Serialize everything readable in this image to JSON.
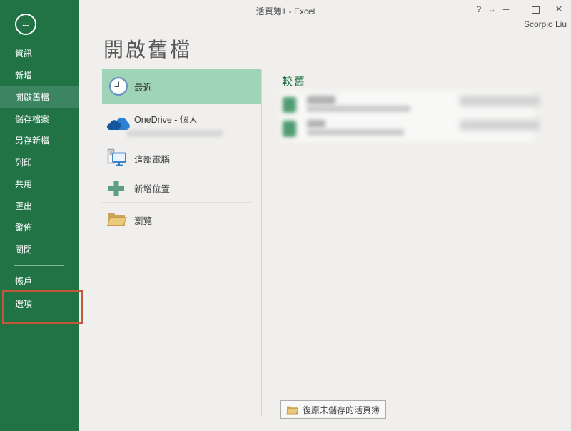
{
  "titlebar": {
    "title": "活頁簿1 - Excel",
    "user": "Scorpio Liu",
    "controls": {
      "help": "?",
      "fullscreen": "↔",
      "minimize": "─",
      "close": "✕"
    }
  },
  "sidebar": {
    "items": [
      {
        "label": "資訊"
      },
      {
        "label": "新增"
      },
      {
        "label": "開啟舊檔",
        "selected": true
      },
      {
        "label": "儲存檔案"
      },
      {
        "label": "另存新檔"
      },
      {
        "label": "列印"
      },
      {
        "label": "共用"
      },
      {
        "label": "匯出"
      },
      {
        "label": "發佈"
      },
      {
        "label": "關閉"
      }
    ],
    "footer_items": [
      {
        "label": "帳戶"
      },
      {
        "label": "選項",
        "annotated": true
      }
    ],
    "colors": {
      "bg": "#217346",
      "selected_bg": "#3b8560",
      "annotation_border": "#c05a3b"
    }
  },
  "main": {
    "page_title": "開啟舊檔",
    "places": [
      {
        "label": "最近",
        "icon": "clock-icon",
        "selected": true
      },
      {
        "label": "OneDrive - 個人",
        "icon": "onedrive-icon",
        "subtext_blurred": true
      },
      {
        "label": "這部電腦",
        "icon": "computer-icon"
      },
      {
        "label": "新增位置",
        "icon": "add-place-icon"
      },
      {
        "label": "瀏覽",
        "icon": "browse-folder-icon"
      }
    ],
    "files": {
      "group_header": "較舊",
      "blurred_items": 2
    },
    "recover_button": "復原未儲存的活頁簿"
  },
  "colors": {
    "selected_place_bg": "#9fd4b6",
    "page_bg": "#f0efed",
    "header_green": "#217346"
  }
}
